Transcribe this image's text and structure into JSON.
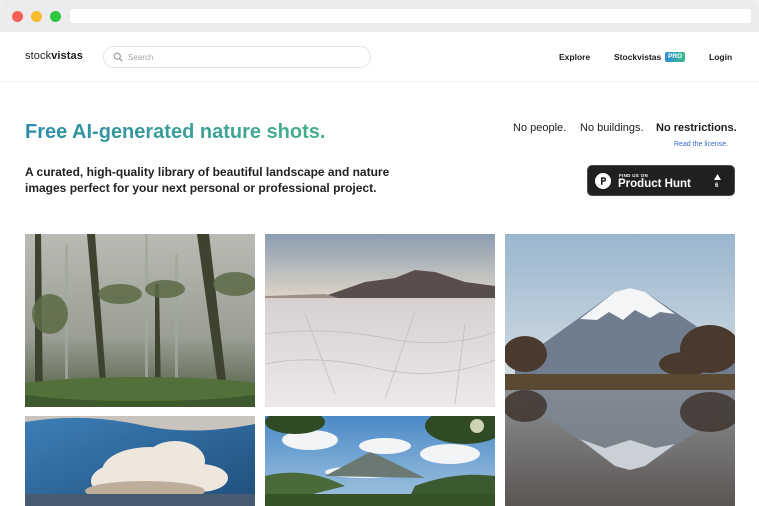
{
  "nav": {
    "logo_prefix": "stock",
    "logo_bold": "vistas",
    "search_placeholder": "Search",
    "explore": "Explore",
    "pro_label": "Stockvistas",
    "pro_badge": "PRO",
    "login": "Login"
  },
  "hero": {
    "title": "Free AI-generated nature shots.",
    "subtitle": "A curated, high-quality library of beautiful landscape and nature images perfect for your next personal or professional project."
  },
  "taglines": [
    "No people.",
    "No buildings.",
    "No restrictions."
  ],
  "license_link": "Read the license.",
  "product_hunt": {
    "find_us": "FIND US ON",
    "name": "Product Hunt",
    "upvotes": "6"
  },
  "colors": {
    "title_gradient_start": "#2c8ca9",
    "title_gradient_end": "#46b08a",
    "link": "#3b68c8"
  },
  "gallery": [
    {
      "name": "misty-forest-image"
    },
    {
      "name": "salt-flats-mountain-image"
    },
    {
      "name": "snowy-volcano-lake-image"
    },
    {
      "name": "storm-cloud-image"
    },
    {
      "name": "mountain-valley-clouds-image"
    }
  ]
}
